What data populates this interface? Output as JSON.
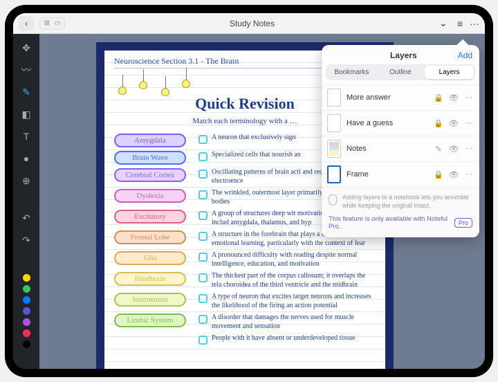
{
  "topbar": {
    "title": "Study Notes",
    "back_icon": "‹",
    "chevron_icon": "⌄",
    "list_icon": "≡",
    "more_icon": "···"
  },
  "lefttools": {
    "icons": [
      "move",
      "brush",
      "pen",
      "eraser",
      "text",
      "mic",
      "add",
      "undo",
      "redo"
    ],
    "colors": [
      "#ffd60a",
      "#34c759",
      "#007aff",
      "#5856d6",
      "#af52de",
      "#ff2d55",
      "#000000"
    ]
  },
  "page": {
    "subject": "Neuroscience Section 3.1 - The Brain",
    "heading": "Quick Revision",
    "instruction": "Match each terminology with a …",
    "items": [
      {
        "term": "Amygdala",
        "bg": "#dcd1ff",
        "border": "#7a5cff",
        "def": "A neuron that exclusively sign"
      },
      {
        "term": "Brain Wave",
        "bg": "#cfe0ff",
        "border": "#4a6dff",
        "def": "Specialized cells that nourish an"
      },
      {
        "term": "Cerebral Cortex",
        "bg": "#e4d3ff",
        "border": "#8a5fff",
        "def": "Oscillating patterns of brain acti\nand recorded using electroence"
      },
      {
        "term": "Dyslexia",
        "bg": "#f6d3f2",
        "border": "#c95fbf",
        "def": "The wrinkled, outermost layer\nprimarily of neuron cell bodies"
      },
      {
        "term": "Excitatory",
        "bg": "#ffd3df",
        "border": "#e05f8a",
        "def": "A group of structures deep wit\nmotivation and emotion, includ\namygdala, thalamus, and hyp"
      },
      {
        "term": "Frontal Lobe",
        "bg": "#ffe0cc",
        "border": "#e08b4f",
        "def": "A structure in the forebrain that plays a central role in\nemotional learning, particularly with the context of fear"
      },
      {
        "term": "Glia",
        "bg": "#ffeacc",
        "border": "#e0a94f",
        "def": "A pronounced difficulty with reading despite normal\nintelligence, education, and motivation"
      },
      {
        "term": "Hindbrain",
        "bg": "#fff4cc",
        "border": "#d6bf4f",
        "def": "The thickest part of the corpus callosum; it overlaps\nthe tela choroidea of the third ventricle and\nthe midbrain"
      },
      {
        "term": "Interneuron",
        "bg": "#f0f7c6",
        "border": "#aac24f",
        "def": "A type of neuron that excites target neurons and\nincreases the likelihood of the firing an action potential"
      },
      {
        "term": "Limbic System",
        "bg": "#e0f5c6",
        "border": "#7fbf4f",
        "def": "A disorder that damages the nerves used for\nmuscle movement and sensation"
      },
      {
        "term": "",
        "bg": "#ffffff",
        "border": "#ffffff",
        "def": "People with it have absent or underdeveloped tissue"
      }
    ]
  },
  "layers_panel": {
    "title": "Layers",
    "add": "Add",
    "tabs": {
      "a": "Bookmarks",
      "b": "Outline",
      "c": "Layers"
    },
    "rows": [
      {
        "name": "More answer",
        "lock": "🔒",
        "eye": "👁",
        "more": "···"
      },
      {
        "name": "Have a guess",
        "lock": "🔒",
        "eye": "👁",
        "more": "···"
      },
      {
        "name": "Notes",
        "lock": "✎",
        "eye": "👁",
        "more": "···"
      },
      {
        "name": "Frame",
        "lock": "🔒",
        "eye": "👁",
        "more": "···"
      }
    ],
    "tip": "Adding layers to a notebook lets you annotate while keeping the original intact.",
    "pro_text": "This feature is only available with Noteful Pro.",
    "pro_badge": "Pro"
  }
}
